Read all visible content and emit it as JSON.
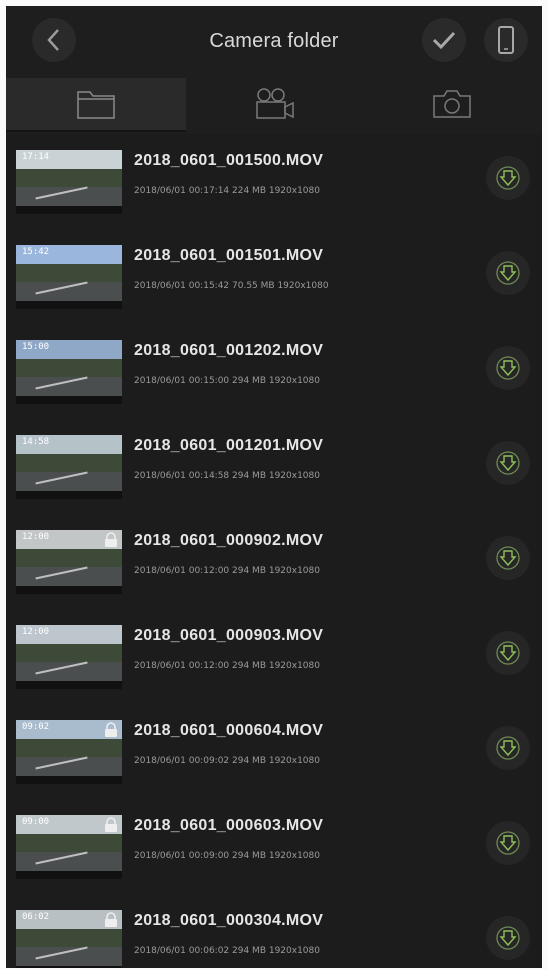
{
  "header": {
    "title": "Camera folder",
    "back_icon": "chevron-left-icon",
    "confirm_icon": "checkmark-icon",
    "device_icon": "phone-icon"
  },
  "tabs": [
    {
      "name": "folder",
      "icon": "folder-icon",
      "selected": true
    },
    {
      "name": "video",
      "icon": "video-camera-icon",
      "selected": false
    },
    {
      "name": "photo",
      "icon": "camera-icon",
      "selected": false
    }
  ],
  "colors": {
    "background": "#1c1c1c",
    "accent": "#8fbf5a",
    "text": "#e6e6e6"
  },
  "files": [
    {
      "name": "2018_0601_001500.MOV",
      "meta": "2018/06/01 00:17:14  224 MB  1920x1080",
      "stamp": "17:14",
      "locked": false
    },
    {
      "name": "2018_0601_001501.MOV",
      "meta": "2018/06/01 00:15:42  70.55 MB  1920x1080",
      "stamp": "15:42",
      "locked": false
    },
    {
      "name": "2018_0601_001202.MOV",
      "meta": "2018/06/01 00:15:00  294 MB  1920x1080",
      "stamp": "15:00",
      "locked": false
    },
    {
      "name": "2018_0601_001201.MOV",
      "meta": "2018/06/01 00:14:58  294 MB  1920x1080",
      "stamp": "14:58",
      "locked": false
    },
    {
      "name": "2018_0601_000902.MOV",
      "meta": "2018/06/01 00:12:00  294 MB  1920x1080",
      "stamp": "12:00",
      "locked": true
    },
    {
      "name": "2018_0601_000903.MOV",
      "meta": "2018/06/01 00:12:00  294 MB  1920x1080",
      "stamp": "12:00",
      "locked": false
    },
    {
      "name": "2018_0601_000604.MOV",
      "meta": "2018/06/01 00:09:02  294 MB  1920x1080",
      "stamp": "09:02",
      "locked": true
    },
    {
      "name": "2018_0601_000603.MOV",
      "meta": "2018/06/01 00:09:00  294 MB  1920x1080",
      "stamp": "09:00",
      "locked": true
    },
    {
      "name": "2018_0601_000304.MOV",
      "meta": "2018/06/01 00:06:02  294 MB  1920x1080",
      "stamp": "06:02",
      "locked": true
    }
  ]
}
